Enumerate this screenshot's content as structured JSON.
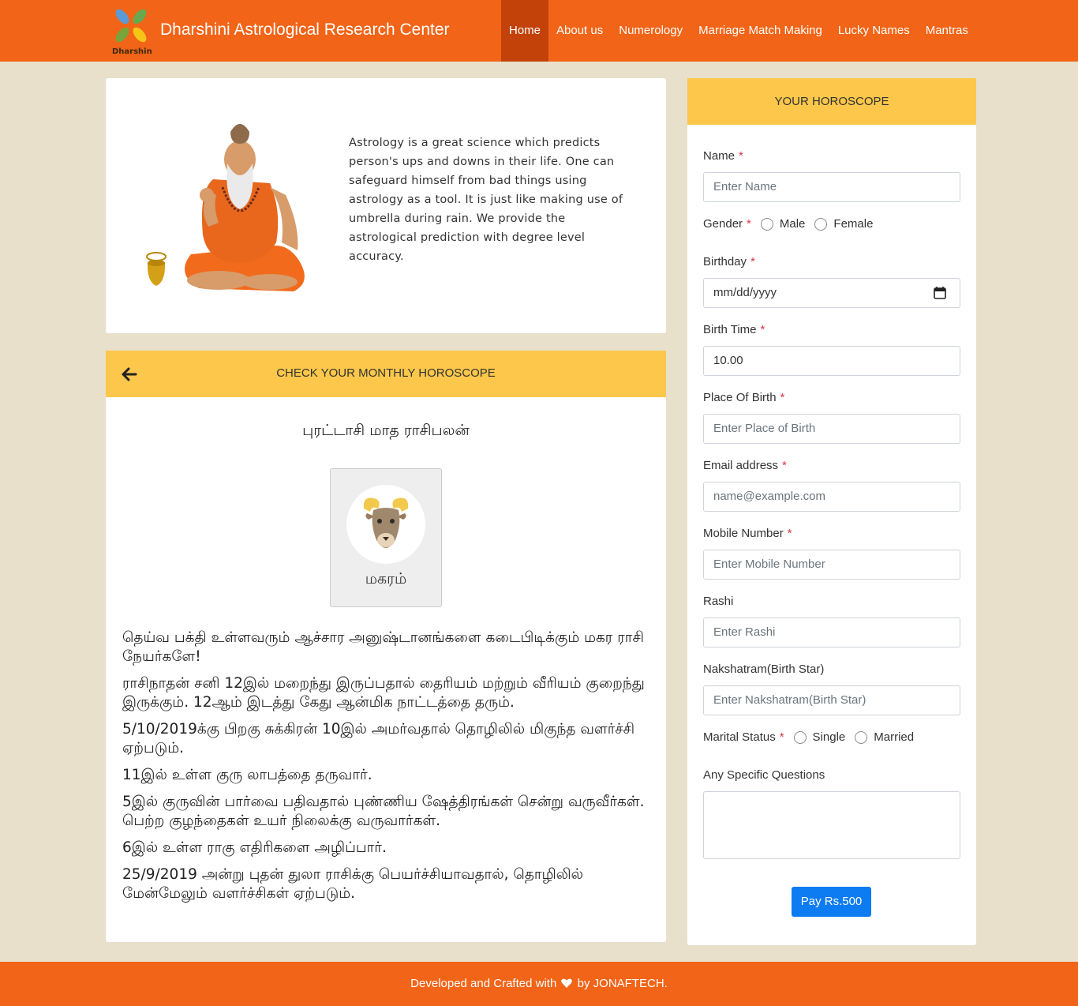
{
  "header": {
    "logo_text": "Dharshini",
    "brand_title": "Dharshini Astrological Research Center",
    "nav": [
      {
        "label": "Home",
        "active": true
      },
      {
        "label": "About us"
      },
      {
        "label": "Numerology"
      },
      {
        "label": "Marriage Match Making"
      },
      {
        "label": "Lucky Names"
      },
      {
        "label": "Mantras"
      }
    ]
  },
  "intro": {
    "text": "Astrology is a great science which predicts person's ups and downs in their life. One can safeguard himself from bad things using astrology as a tool. It is just like making use of umbrella during rain. We provide the astrological prediction with degree level accuracy."
  },
  "monthly": {
    "header_title": "CHECK YOUR MONTHLY HOROSCOPE",
    "back_icon": "arrow-left-icon",
    "month_title": "புரட்டாசி மாத ராசிபலன்",
    "sign_icon": "ram-icon",
    "sign_label": "மகரம்",
    "predictions": [
      "தெய்வ பக்தி உள்ளவரும் ஆச்சார அனுஷ்டானங்களை கடைபிடிக்கும் மகர ராசி நேயர்களே!",
      "ராசிநாதன் சனி 12இல் மறைந்து இருப்பதால் தைரியம் மற்றும் வீரியம் குறைந்து இருக்கும். 12ஆம் இடத்து கேது ஆன்மிக நாட்டத்தை தரும்.",
      "5/10/2019க்கு பிறகு சுக்கிரன் 10இல் அமர்வதால் தொழிலில் மிகுந்த வளர்ச்சி ஏற்படும்.",
      "11இல் உள்ள குரு லாபத்தை தருவார்.",
      "5இல் குருவின் பார்வை பதிவதால் புண்ணிய ஷேத்திரங்கள் சென்று வருவீர்கள். பெற்ற குழந்தைகள் உயர் நிலைக்கு வருவார்கள்.",
      "6இல் உள்ள ராகு எதிரிகளை அழிப்பார்.",
      "25/9/2019 அன்று புதன் துலா ராசிக்கு பெயர்ச்சியாவதால், தொழிலில் மேன்மேலும் வளர்ச்சிகள் ஏற்படும்."
    ]
  },
  "form": {
    "header_title": "YOUR HOROSCOPE",
    "name_label": "Name",
    "name_placeholder": "Enter Name",
    "gender_label": "Gender",
    "gender_options": [
      "Male",
      "Female"
    ],
    "birthday_label": "Birthday",
    "birthday_placeholder": "mm/dd/yyyy",
    "birth_time_label": "Birth Time",
    "birth_time_value": "10.00",
    "place_label": "Place Of Birth",
    "place_placeholder": "Enter Place of Birth",
    "email_label": "Email address",
    "email_placeholder": "name@example.com",
    "mobile_label": "Mobile Number",
    "mobile_placeholder": "Enter Mobile Number",
    "rashi_label": "Rashi",
    "rashi_placeholder": "Enter Rashi",
    "nakshatram_label": "Nakshatram(Birth Star)",
    "nakshatram_placeholder": "Enter Nakshatram(Birth Star)",
    "marital_label": "Marital Status",
    "marital_options": [
      "Single",
      "Married"
    ],
    "questions_label": "Any Specific Questions",
    "required_mark": "*",
    "pay_button": "Pay Rs.500"
  },
  "footer": {
    "text_before": "Developed and Crafted with",
    "icon": "heart-icon",
    "text_after": "by JONAFTECH."
  },
  "colors": {
    "brand_orange": "#f26417",
    "nav_active": "#c2420a",
    "card_header_yellow": "#fcc74a",
    "page_bg": "#e8e0cb",
    "pay_button_blue": "#0d7cf2",
    "required_red": "#dc3545"
  }
}
